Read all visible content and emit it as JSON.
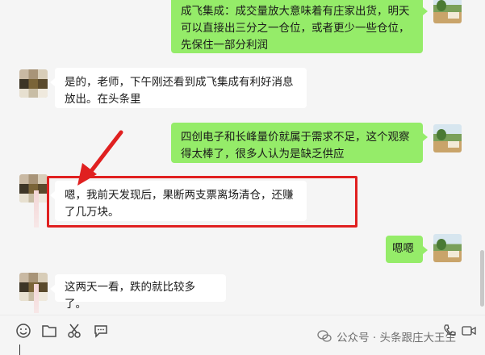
{
  "messages": [
    {
      "id": "m1",
      "side": "out",
      "text": "成飞集成：成交量放大意味着有庄家出货，明天可以直接出三分之一仓位，或者更少一些仓位，先保住一部分利润"
    },
    {
      "id": "m2",
      "side": "in",
      "text": "是的，老师，下午刚还看到成飞集成有利好消息放出。在头条里"
    },
    {
      "id": "m3",
      "side": "out",
      "text": "四创电子和长峰量价就属于需求不足，这个观察得太棒了，很多人认为是缺乏供应"
    },
    {
      "id": "m4",
      "side": "in",
      "text": "嗯，我前天发现后，果断两支票离场清仓，还赚了几万块。"
    },
    {
      "id": "m5",
      "side": "out",
      "text": "嗯嗯"
    },
    {
      "id": "m6",
      "side": "in",
      "text": "这两天一看，跌的就比较多了。"
    }
  ],
  "annotation": {
    "box_color": "#e02020",
    "arrow_color": "#e02020"
  },
  "toolbar": {
    "icons": [
      "emoji-icon",
      "folder-icon",
      "scissors-icon",
      "chat-bubble-icon"
    ],
    "right_icons": [
      "phone-icon",
      "video-icon"
    ]
  },
  "watermark": {
    "text": "公众号 · 头条跟庄大王生"
  },
  "colors": {
    "outgoing_bubble": "#95ec69",
    "incoming_bubble": "#ffffff",
    "background": "#f5f5f5"
  }
}
